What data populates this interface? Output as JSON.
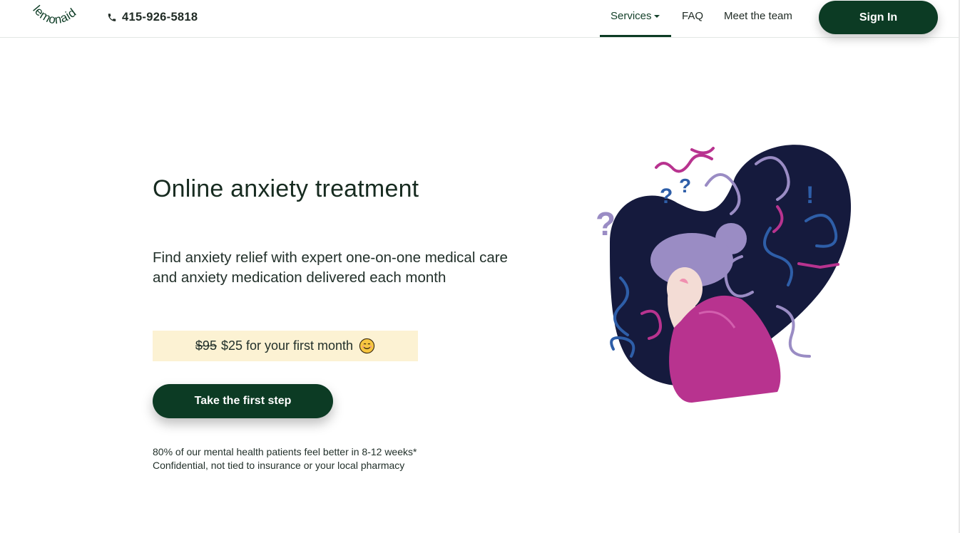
{
  "header": {
    "logo_text": "lemonaid",
    "phone": "415-926-5818",
    "nav": {
      "services": "Services",
      "faq": "FAQ",
      "team": "Meet the team"
    },
    "signin": "Sign In"
  },
  "hero": {
    "title": "Online anxiety treatment",
    "subtitle": "Find anxiety relief with expert one-on-one medical care and anxiety medication delivered each month",
    "promo": {
      "old_price": "$95",
      "new_text": "$25 for your first month"
    },
    "cta": "Take the first step",
    "footnote1": "80% of our mental health patients feel better in 8-12 weeks*",
    "footnote2": "Confidential, not tied to insurance or your local pharmacy"
  },
  "colors": {
    "brand_green": "#0c3b24",
    "promo_bg": "#fcf2d3",
    "navy_blob": "#151a3d",
    "magenta": "#b8338f",
    "lavender": "#9a8cc4",
    "blue": "#2e5ea8"
  }
}
